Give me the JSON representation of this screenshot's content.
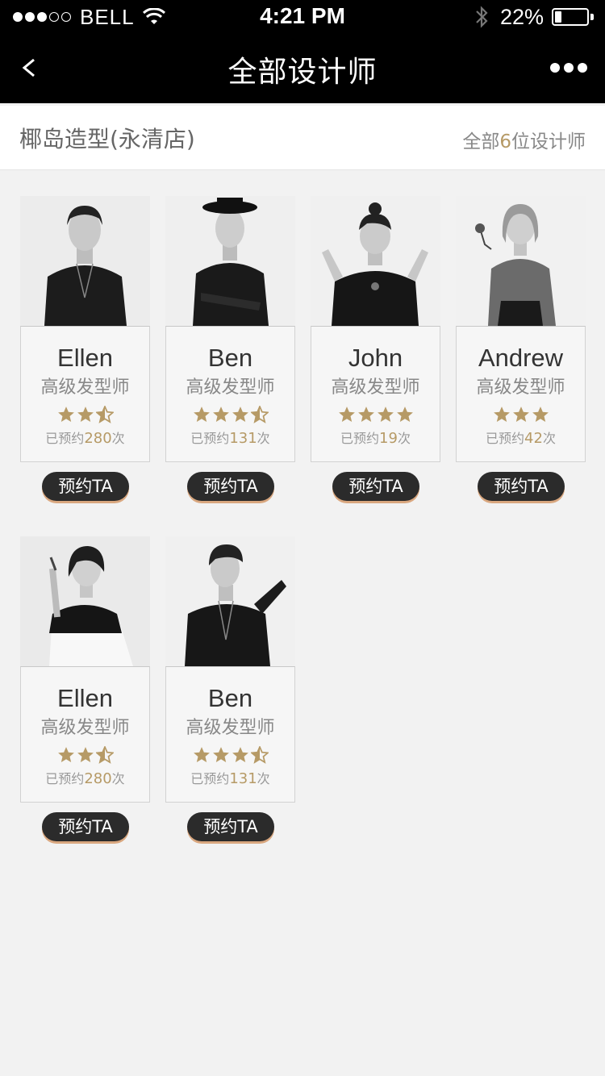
{
  "status_bar": {
    "carrier": "BELL",
    "time": "4:21 PM",
    "battery_percent": "22%",
    "battery_level": 0.22
  },
  "nav": {
    "back_label": "<",
    "title": "全部设计师"
  },
  "shop": {
    "name": "椰岛造型(永清店)",
    "count_prefix": "全部",
    "count_value": "6",
    "count_suffix": "位设计师"
  },
  "colors": {
    "accent_gold": "#b69a66",
    "button_bg": "#2b2b2b",
    "button_shadow": "#d9a77f"
  },
  "designers": [
    {
      "name": "Ellen",
      "title": "高级发型师",
      "rating": 2.5,
      "booked_prefix": "已预约",
      "booked_count": "280",
      "booked_suffix": "次",
      "button_label": "预约TA"
    },
    {
      "name": "Ben",
      "title": "高级发型师",
      "rating": 3.5,
      "booked_prefix": "已预约",
      "booked_count": "131",
      "booked_suffix": "次",
      "button_label": "预约TA"
    },
    {
      "name": "John",
      "title": "高级发型师",
      "rating": 4,
      "booked_prefix": "已预约",
      "booked_count": "19",
      "booked_suffix": "次",
      "button_label": "预约TA"
    },
    {
      "name": "Andrew",
      "title": "高级发型师",
      "rating": 3,
      "booked_prefix": "已预约",
      "booked_count": "42",
      "booked_suffix": "次",
      "button_label": "预约TA"
    },
    {
      "name": "Ellen",
      "title": "高级发型师",
      "rating": 2.5,
      "booked_prefix": "已预约",
      "booked_count": "280",
      "booked_suffix": "次",
      "button_label": "预约TA"
    },
    {
      "name": "Ben",
      "title": "高级发型师",
      "rating": 3.5,
      "booked_prefix": "已预约",
      "booked_count": "131",
      "booked_suffix": "次",
      "button_label": "预约TA"
    }
  ]
}
